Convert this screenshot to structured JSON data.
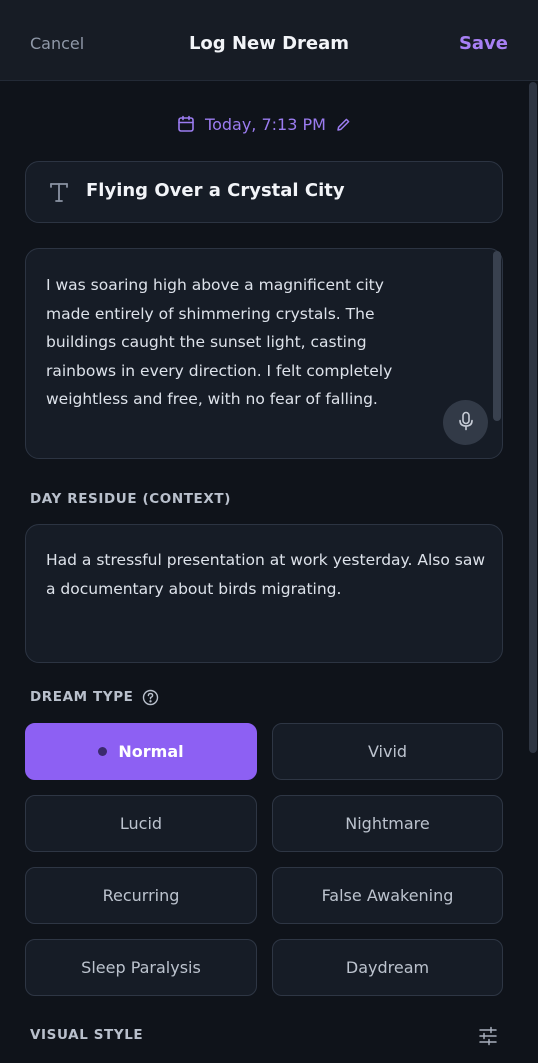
{
  "header": {
    "cancel_label": "Cancel",
    "title": "Log New Dream",
    "save_label": "Save"
  },
  "date": {
    "text": "Today, 7:13 PM"
  },
  "dream_title": {
    "value": "Flying Over a Crystal City"
  },
  "description": {
    "value": "I was soaring high above a magnificent city made entirely of shimmering crystals. The buildings caught the sunset light, casting rainbows in every direction. I felt completely weightless and free, with no fear of falling."
  },
  "day_residue": {
    "label": "DAY RESIDUE (CONTEXT)",
    "value": "Had a stressful presentation at work yesterday. Also saw a documentary about birds migrating."
  },
  "dream_type": {
    "label": "DREAM TYPE",
    "selected": "Normal",
    "options": [
      "Normal",
      "Vivid",
      "Lucid",
      "Nightmare",
      "Recurring",
      "False Awakening",
      "Sleep Paralysis",
      "Daydream"
    ]
  },
  "visual_style": {
    "label": "VISUAL STYLE"
  },
  "colors": {
    "accent": "#8d60f3",
    "accent_text": "#a880f5",
    "background": "#0f131a",
    "card": "#161c26"
  }
}
